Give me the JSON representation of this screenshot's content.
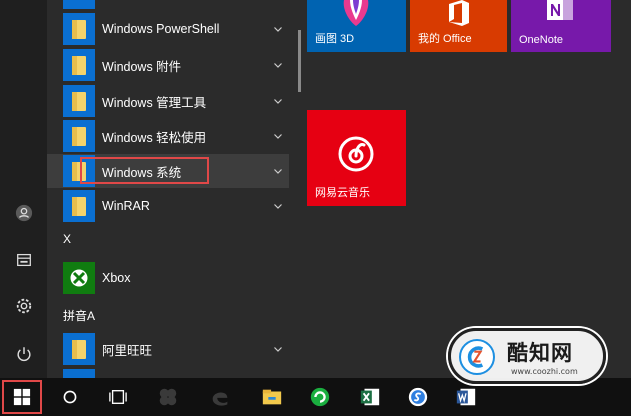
{
  "app_list": {
    "rows": [
      {
        "label": "Windows PowerShell"
      },
      {
        "label": "Windows 附件"
      },
      {
        "label": "Windows 管理工具"
      },
      {
        "label": "Windows 轻松使用"
      },
      {
        "label": "Windows 系统"
      },
      {
        "label": "WinRAR"
      }
    ],
    "section_x": "X",
    "xbox_label": "Xbox",
    "section_pinyin_a": "拼音A",
    "aliwangwang_label": "阿里旺旺"
  },
  "tiles": {
    "paint3d": {
      "label": "画图 3D",
      "color": "#0063b1"
    },
    "my_office": {
      "label": "我的 Office",
      "color": "#d83b01"
    },
    "onenote": {
      "label": "OneNote",
      "color": "#7719aa"
    },
    "netease_music": {
      "label": "网易云音乐",
      "color": "#e60012"
    }
  },
  "rail_icons": [
    "user-icon",
    "documents-icon",
    "settings-icon",
    "power-icon"
  ],
  "taskbar_icons": [
    "start-icon",
    "cortana-icon",
    "task-view-icon",
    "app-icon",
    "edge-icon",
    "file-explorer-icon",
    "360-browser-icon",
    "excel-icon",
    "sogou-icon",
    "word-icon"
  ],
  "watermark": {
    "brand": "酷知网",
    "url": "www.coozhi.com"
  },
  "colors": {
    "highlight": "#e04848",
    "accent": "#0a6fd1"
  }
}
